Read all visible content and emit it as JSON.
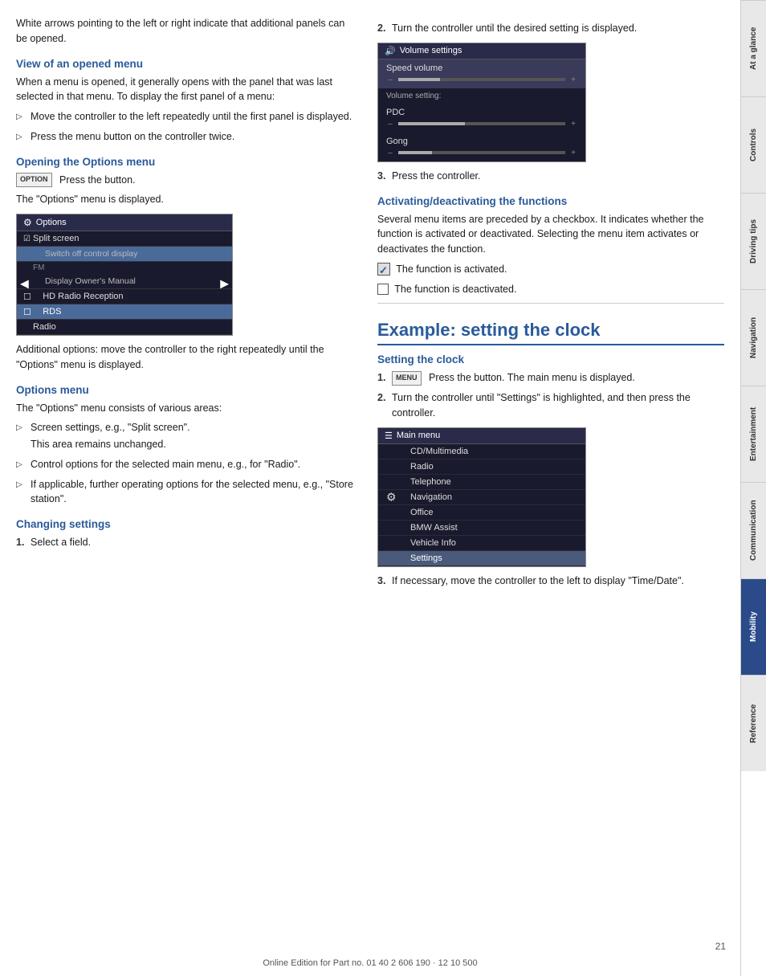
{
  "page": {
    "footer": "Online Edition for Part no. 01 40 2 606 190 · 12 10 500",
    "page_number": "21"
  },
  "sidebar": {
    "tabs": [
      {
        "id": "at-a-glance",
        "label": "At a glance",
        "active": false
      },
      {
        "id": "controls",
        "label": "Controls",
        "active": false
      },
      {
        "id": "driving-tips",
        "label": "Driving tips",
        "active": false
      },
      {
        "id": "navigation",
        "label": "Navigation",
        "active": false
      },
      {
        "id": "entertainment",
        "label": "Entertainment",
        "active": false
      },
      {
        "id": "communication",
        "label": "Communication",
        "active": false
      },
      {
        "id": "mobility",
        "label": "Mobility",
        "active": true
      },
      {
        "id": "reference",
        "label": "Reference",
        "active": false
      }
    ]
  },
  "left_col": {
    "intro_text": "White arrows pointing to the left or right indicate that additional panels can be opened.",
    "view_opened_menu": {
      "heading": "View of an opened menu",
      "body": "When a menu is opened, it generally opens with the panel that was last selected in that menu. To display the first panel of a menu:",
      "bullets": [
        "Move the controller to the left repeatedly until the first panel is displayed.",
        "Press the menu button on the controller twice."
      ]
    },
    "opening_options_menu": {
      "heading": "Opening the Options menu",
      "option_btn_label": "OPTION",
      "body_after_btn": "Press the button.",
      "body2": "The \"Options\" menu is displayed.",
      "screenshot": {
        "title": "Options",
        "title_icon": "⚙",
        "items": [
          {
            "type": "item",
            "text": "Split screen",
            "checked": true,
            "highlighted": false
          },
          {
            "type": "sub",
            "text": "Switch off control display",
            "highlighted": true
          },
          {
            "type": "label",
            "text": "FM"
          },
          {
            "type": "sub",
            "text": "Display Owner's Manual",
            "highlighted": false
          },
          {
            "type": "item",
            "text": "HD Radio Reception",
            "checked": false,
            "highlighted": false
          },
          {
            "type": "item",
            "text": "RDS",
            "checked": false,
            "highlighted": true
          },
          {
            "type": "item",
            "text": "Radio",
            "checked": false,
            "highlighted": false
          }
        ]
      }
    },
    "additional_options_text": "Additional options: move the controller to the right repeatedly until the \"Options\" menu is displayed.",
    "options_menu": {
      "heading": "Options menu",
      "body": "The \"Options\" menu consists of various areas:",
      "bullets": [
        {
          "text": "Screen settings, e.g., \"Split screen\".",
          "sub": "This area remains unchanged."
        },
        {
          "text": "Control options for the selected main menu, e.g., for \"Radio\".",
          "sub": null
        },
        {
          "text": "If applicable, further operating options for the selected menu, e.g., \"Store station\".",
          "sub": null
        }
      ]
    },
    "changing_settings": {
      "heading": "Changing settings",
      "steps": [
        {
          "num": "1.",
          "text": "Select a field."
        }
      ]
    }
  },
  "right_col": {
    "step2_text": "Turn the controller until the desired setting is displayed.",
    "vol_screenshot": {
      "title": "Volume settings",
      "title_icon": "♪",
      "items": [
        {
          "label": "Speed volume",
          "has_slider": true,
          "fill_percent": 25
        },
        {
          "label": "Volume setting:",
          "is_header": true
        },
        {
          "label": "PDC",
          "has_slider": true,
          "fill_percent": 40
        },
        {
          "label": "Gong",
          "has_slider": true,
          "fill_percent": 20
        }
      ]
    },
    "step3_text": "Press the controller.",
    "activating_deactivating": {
      "heading": "Activating/deactivating the functions",
      "body": "Several menu items are preceded by a checkbox. It indicates whether the function is activated or deactivated. Selecting the menu item activates or deactivates the function.",
      "checked_text": "The function is activated.",
      "unchecked_text": "The function is deactivated."
    },
    "example_clock": {
      "heading": "Example: setting the clock",
      "sub_heading": "Setting the clock",
      "steps": [
        {
          "num": "1.",
          "btn": "MENU",
          "text": "Press the button. The main menu is displayed."
        },
        {
          "num": "2.",
          "text": "Turn the controller until \"Settings\" is highlighted, and then press the controller."
        }
      ],
      "main_menu_screenshot": {
        "title": "Main menu",
        "title_icon": "☰",
        "items": [
          {
            "text": "CD/Multimedia",
            "highlighted": false,
            "has_gear": false
          },
          {
            "text": "Radio",
            "highlighted": false,
            "has_gear": false
          },
          {
            "text": "Telephone",
            "highlighted": false,
            "has_gear": false
          },
          {
            "text": "Navigation",
            "highlighted": false,
            "has_gear": true
          },
          {
            "text": "Office",
            "highlighted": false,
            "has_gear": false
          },
          {
            "text": "BMW Assist",
            "highlighted": false,
            "has_gear": false
          },
          {
            "text": "Vehicle Info",
            "highlighted": false,
            "has_gear": false
          },
          {
            "text": "Settings",
            "highlighted": true,
            "has_gear": false
          }
        ]
      },
      "step3_text": "If necessary, move the controller to the left to display \"Time/Date\"."
    }
  }
}
